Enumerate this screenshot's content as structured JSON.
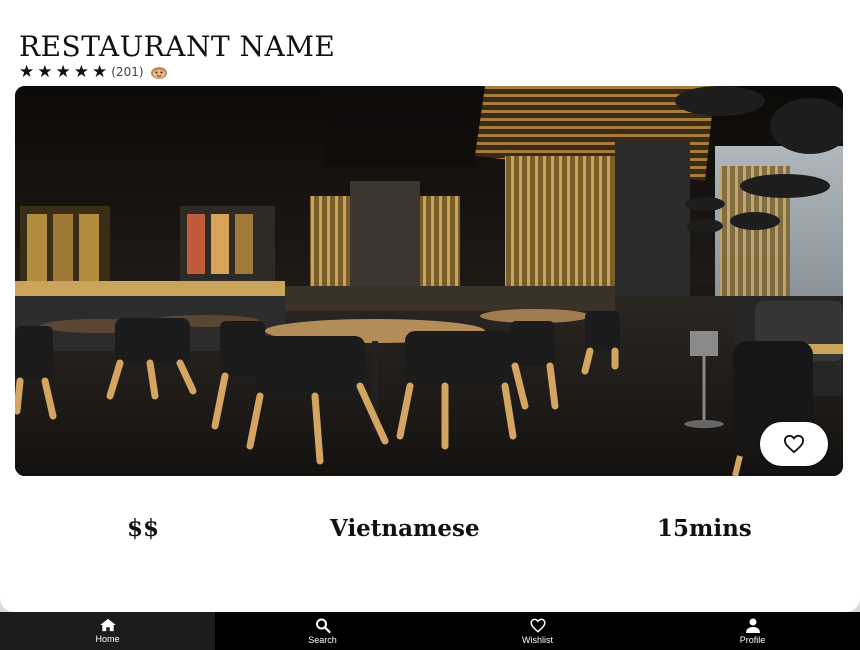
{
  "restaurant": {
    "name": "RESTAURANT NAME",
    "rating": 5,
    "review_count": "(201)",
    "price": "$$",
    "cuisine": "Vietnamese",
    "time": "15mins"
  },
  "stars": [
    "★",
    "★",
    "★",
    "★",
    "★"
  ],
  "photo": {
    "icon": "restaurant-interior-photo"
  },
  "wishlist_button": {
    "icon": "heart-icon"
  },
  "nav": {
    "items": [
      {
        "label": "Home",
        "icon": "home-icon",
        "active": true
      },
      {
        "label": "Search",
        "icon": "search-icon",
        "active": false
      },
      {
        "label": "Wishlist",
        "icon": "heart-icon",
        "active": false
      },
      {
        "label": "Profile",
        "icon": "person-icon",
        "active": false
      }
    ]
  },
  "colors": {
    "background": "#ffffff",
    "nav_background": "#000000",
    "nav_active": "#1c1c1c",
    "text": "#111111"
  }
}
